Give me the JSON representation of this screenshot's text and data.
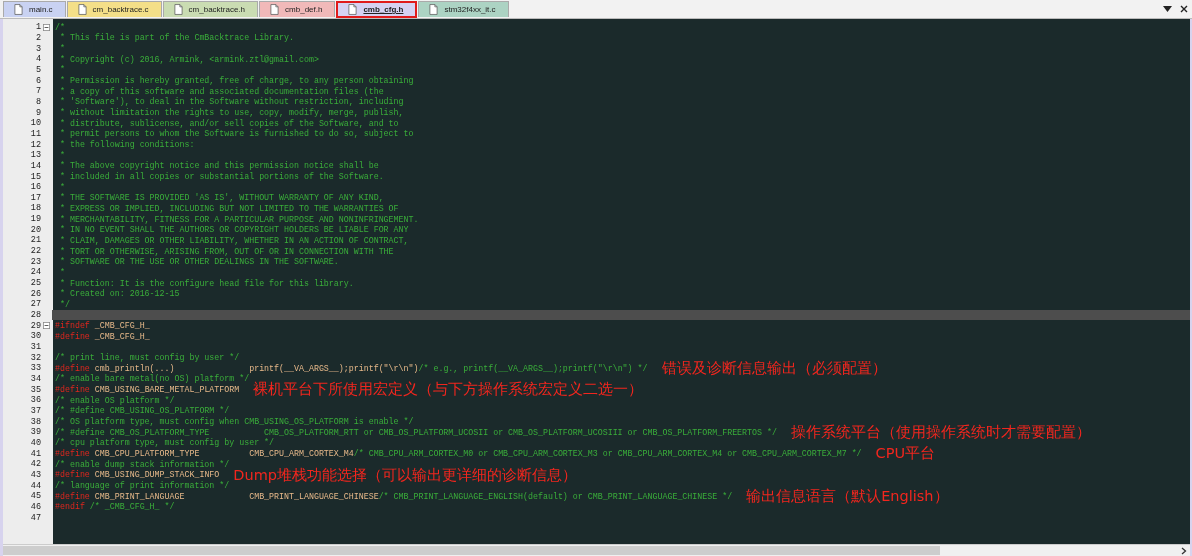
{
  "tabs": [
    {
      "label": "main.c",
      "selected": false,
      "color": "#c9d2f2"
    },
    {
      "label": "cm_backtrace.c",
      "selected": false,
      "color": "#f4df88"
    },
    {
      "label": "cm_backtrace.h",
      "selected": false,
      "color": "#cadcb2"
    },
    {
      "label": "cmb_def.h",
      "selected": false,
      "color": "#f1b9b9"
    },
    {
      "label": "cmb_cfg.h",
      "selected": true,
      "color": "#d6d2f2"
    },
    {
      "label": "stm32f4xx_it.c",
      "selected": false,
      "color": "#acd3c3"
    }
  ],
  "lines": [
    {
      "number": "1",
      "fold": true,
      "selected": false,
      "tokens": [
        {
          "kind": "comment",
          "text": "/*"
        }
      ]
    },
    {
      "number": "2",
      "fold": false,
      "selected": false,
      "tokens": [
        {
          "kind": "comment",
          "text": " * This file is part of the CmBacktrace Library."
        }
      ]
    },
    {
      "number": "3",
      "fold": false,
      "selected": false,
      "tokens": [
        {
          "kind": "comment",
          "text": " *"
        }
      ]
    },
    {
      "number": "4",
      "fold": false,
      "selected": false,
      "tokens": [
        {
          "kind": "comment",
          "text": " * Copyright (c) 2016, Armink, <armink.ztl@gmail.com>"
        }
      ]
    },
    {
      "number": "5",
      "fold": false,
      "selected": false,
      "tokens": [
        {
          "kind": "comment",
          "text": " *"
        }
      ]
    },
    {
      "number": "6",
      "fold": false,
      "selected": false,
      "tokens": [
        {
          "kind": "comment",
          "text": " * Permission is hereby granted, free of charge, to any person obtaining"
        }
      ]
    },
    {
      "number": "7",
      "fold": false,
      "selected": false,
      "tokens": [
        {
          "kind": "comment",
          "text": " * a copy of this software and associated documentation files (the"
        }
      ]
    },
    {
      "number": "8",
      "fold": false,
      "selected": false,
      "tokens": [
        {
          "kind": "comment",
          "text": " * 'Software'), to deal in the Software without restriction, including"
        }
      ]
    },
    {
      "number": "9",
      "fold": false,
      "selected": false,
      "tokens": [
        {
          "kind": "comment",
          "text": " * without limitation the rights to use, copy, modify, merge, publish,"
        }
      ]
    },
    {
      "number": "10",
      "fold": false,
      "selected": false,
      "tokens": [
        {
          "kind": "comment",
          "text": " * distribute, sublicense, and/or sell copies of the Software, and to"
        }
      ]
    },
    {
      "number": "11",
      "fold": false,
      "selected": false,
      "tokens": [
        {
          "kind": "comment",
          "text": " * permit persons to whom the Software is furnished to do so, subject to"
        }
      ]
    },
    {
      "number": "12",
      "fold": false,
      "selected": false,
      "tokens": [
        {
          "kind": "comment",
          "text": " * the following conditions:"
        }
      ]
    },
    {
      "number": "13",
      "fold": false,
      "selected": false,
      "tokens": [
        {
          "kind": "comment",
          "text": " *"
        }
      ]
    },
    {
      "number": "14",
      "fold": false,
      "selected": false,
      "tokens": [
        {
          "kind": "comment",
          "text": " * The above copyright notice and this permission notice shall be"
        }
      ]
    },
    {
      "number": "15",
      "fold": false,
      "selected": false,
      "tokens": [
        {
          "kind": "comment",
          "text": " * included in all copies or substantial portions of the Software."
        }
      ]
    },
    {
      "number": "16",
      "fold": false,
      "selected": false,
      "tokens": [
        {
          "kind": "comment",
          "text": " *"
        }
      ]
    },
    {
      "number": "17",
      "fold": false,
      "selected": false,
      "tokens": [
        {
          "kind": "comment",
          "text": " * THE SOFTWARE IS PROVIDED 'AS IS', WITHOUT WARRANTY OF ANY KIND,"
        }
      ]
    },
    {
      "number": "18",
      "fold": false,
      "selected": false,
      "tokens": [
        {
          "kind": "comment",
          "text": " * EXPRESS OR IMPLIED, INCLUDING BUT NOT LIMITED TO THE WARRANTIES OF"
        }
      ]
    },
    {
      "number": "19",
      "fold": false,
      "selected": false,
      "tokens": [
        {
          "kind": "comment",
          "text": " * MERCHANTABILITY, FITNESS FOR A PARTICULAR PURPOSE AND NONINFRINGEMENT."
        }
      ]
    },
    {
      "number": "20",
      "fold": false,
      "selected": false,
      "tokens": [
        {
          "kind": "comment",
          "text": " * IN NO EVENT SHALL THE AUTHORS OR COPYRIGHT HOLDERS BE LIABLE FOR ANY"
        }
      ]
    },
    {
      "number": "21",
      "fold": false,
      "selected": false,
      "tokens": [
        {
          "kind": "comment",
          "text": " * CLAIM, DAMAGES OR OTHER LIABILITY, WHETHER IN AN ACTION OF CONTRACT,"
        }
      ]
    },
    {
      "number": "22",
      "fold": false,
      "selected": false,
      "tokens": [
        {
          "kind": "comment",
          "text": " * TORT OR OTHERWISE, ARISING FROM, OUT OF OR IN CONNECTION WITH THE"
        }
      ]
    },
    {
      "number": "23",
      "fold": false,
      "selected": false,
      "tokens": [
        {
          "kind": "comment",
          "text": " * SOFTWARE OR THE USE OR OTHER DEALINGS IN THE SOFTWARE."
        }
      ]
    },
    {
      "number": "24",
      "fold": false,
      "selected": false,
      "tokens": [
        {
          "kind": "comment",
          "text": " *"
        }
      ]
    },
    {
      "number": "25",
      "fold": false,
      "selected": false,
      "tokens": [
        {
          "kind": "comment",
          "text": " * Function: It is the configure head file for this library."
        }
      ]
    },
    {
      "number": "26",
      "fold": false,
      "selected": false,
      "tokens": [
        {
          "kind": "comment",
          "text": " * Created on: 2016-12-15"
        }
      ]
    },
    {
      "number": "27",
      "fold": false,
      "selected": false,
      "tokens": [
        {
          "kind": "comment",
          "text": " */"
        }
      ]
    },
    {
      "number": "28",
      "fold": false,
      "selected": true
    },
    {
      "number": "29",
      "fold": true,
      "selected": false,
      "tokens": [
        {
          "kind": "keyword",
          "text": "#ifndef"
        },
        {
          "kind": "ident",
          "text": " _CMB_CFG_H_"
        }
      ]
    },
    {
      "number": "30",
      "fold": false,
      "selected": false,
      "tokens": [
        {
          "kind": "keyword",
          "text": "#define"
        },
        {
          "kind": "ident",
          "text": " _CMB_CFG_H_"
        }
      ]
    },
    {
      "number": "31",
      "fold": false,
      "selected": false
    },
    {
      "number": "32",
      "fold": false,
      "selected": false,
      "tokens": [
        {
          "kind": "comment",
          "text": "/* print line, must config by user */"
        }
      ]
    },
    {
      "number": "33",
      "fold": false,
      "selected": false,
      "tokens": [
        {
          "kind": "keyword",
          "text": "#define"
        },
        {
          "kind": "ident",
          "text": " cmb_println(...)               printf(__VA_ARGS__);printf(\"\\r\\n\")"
        },
        {
          "kind": "comment",
          "text": "/* e.g., printf(__VA_ARGS__);printf(\"\\r\\n\") */"
        }
      ],
      "note": "错误及诊断信息输出（必须配置）"
    },
    {
      "number": "34",
      "fold": false,
      "selected": false,
      "tokens": [
        {
          "kind": "comment",
          "text": "/* enable bare metal(no OS) platform */"
        }
      ]
    },
    {
      "number": "35",
      "fold": false,
      "selected": false,
      "tokens": [
        {
          "kind": "keyword",
          "text": "#define"
        },
        {
          "kind": "ident",
          "text": " CMB_USING_BARE_METAL_PLATFORM"
        }
      ],
      "note": "裸机平台下所使用宏定义（与下方操作系统宏定义二选一）"
    },
    {
      "number": "36",
      "fold": false,
      "selected": false,
      "tokens": [
        {
          "kind": "comment",
          "text": "/* enable OS platform */"
        }
      ]
    },
    {
      "number": "37",
      "fold": false,
      "selected": false,
      "tokens": [
        {
          "kind": "comment",
          "text": "/* #define CMB_USING_OS_PLATFORM */"
        }
      ]
    },
    {
      "number": "38",
      "fold": false,
      "selected": false,
      "tokens": [
        {
          "kind": "comment",
          "text": "/* OS platform type, must config when CMB_USING_OS_PLATFORM is enable */"
        }
      ]
    },
    {
      "number": "39",
      "fold": false,
      "selected": false,
      "tokens": [
        {
          "kind": "comment",
          "text": "/* #define CMB_OS_PLATFORM_TYPE           CMB_OS_PLATFORM_RTT or CMB_OS_PLATFORM_UCOSII or CMB_OS_PLATFORM_UCOSIII or CMB_OS_PLATFORM_FREERTOS */"
        }
      ],
      "note": "操作系统平台（使用操作系统时才需要配置）"
    },
    {
      "number": "40",
      "fold": false,
      "selected": false,
      "tokens": [
        {
          "kind": "comment",
          "text": "/* cpu platform type, must config by user */"
        }
      ]
    },
    {
      "number": "41",
      "fold": false,
      "selected": false,
      "tokens": [
        {
          "kind": "keyword",
          "text": "#define"
        },
        {
          "kind": "ident",
          "text": " CMB_CPU_PLATFORM_TYPE          CMB_CPU_ARM_CORTEX_M4"
        },
        {
          "kind": "comment",
          "text": "/* CMB_CPU_ARM_CORTEX_M0 or CMB_CPU_ARM_CORTEX_M3 or CMB_CPU_ARM_CORTEX_M4 or CMB_CPU_ARM_CORTEX_M7 */"
        }
      ],
      "note": "CPU平台"
    },
    {
      "number": "42",
      "fold": false,
      "selected": false,
      "tokens": [
        {
          "kind": "comment",
          "text": "/* enable dump stack information */"
        }
      ]
    },
    {
      "number": "43",
      "fold": false,
      "selected": false,
      "tokens": [
        {
          "kind": "keyword",
          "text": "#define"
        },
        {
          "kind": "ident",
          "text": " CMB_USING_DUMP_STACK_INFO"
        }
      ],
      "note": "Dump堆栈功能选择（可以输出更详细的诊断信息）"
    },
    {
      "number": "44",
      "fold": false,
      "selected": false,
      "tokens": [
        {
          "kind": "comment",
          "text": "/* language of print information */"
        }
      ]
    },
    {
      "number": "45",
      "fold": false,
      "selected": false,
      "tokens": [
        {
          "kind": "keyword",
          "text": "#define"
        },
        {
          "kind": "ident",
          "text": " CMB_PRINT_LANGUAGE             CMB_PRINT_LANGUAGE_CHINESE"
        },
        {
          "kind": "comment",
          "text": "/* CMB_PRINT_LANGUAGE_ENGLISH(default) or CMB_PRINT_LANGUAGE_CHINESE */"
        }
      ],
      "note": "输出信息语言（默认English）"
    },
    {
      "number": "46",
      "fold": false,
      "selected": false,
      "tokens": [
        {
          "kind": "keyword",
          "text": "#endif"
        },
        {
          "kind": "comment",
          "text": " /* _CMB_CFG_H_ */"
        }
      ]
    },
    {
      "number": "47",
      "fold": false,
      "selected": false
    }
  ]
}
